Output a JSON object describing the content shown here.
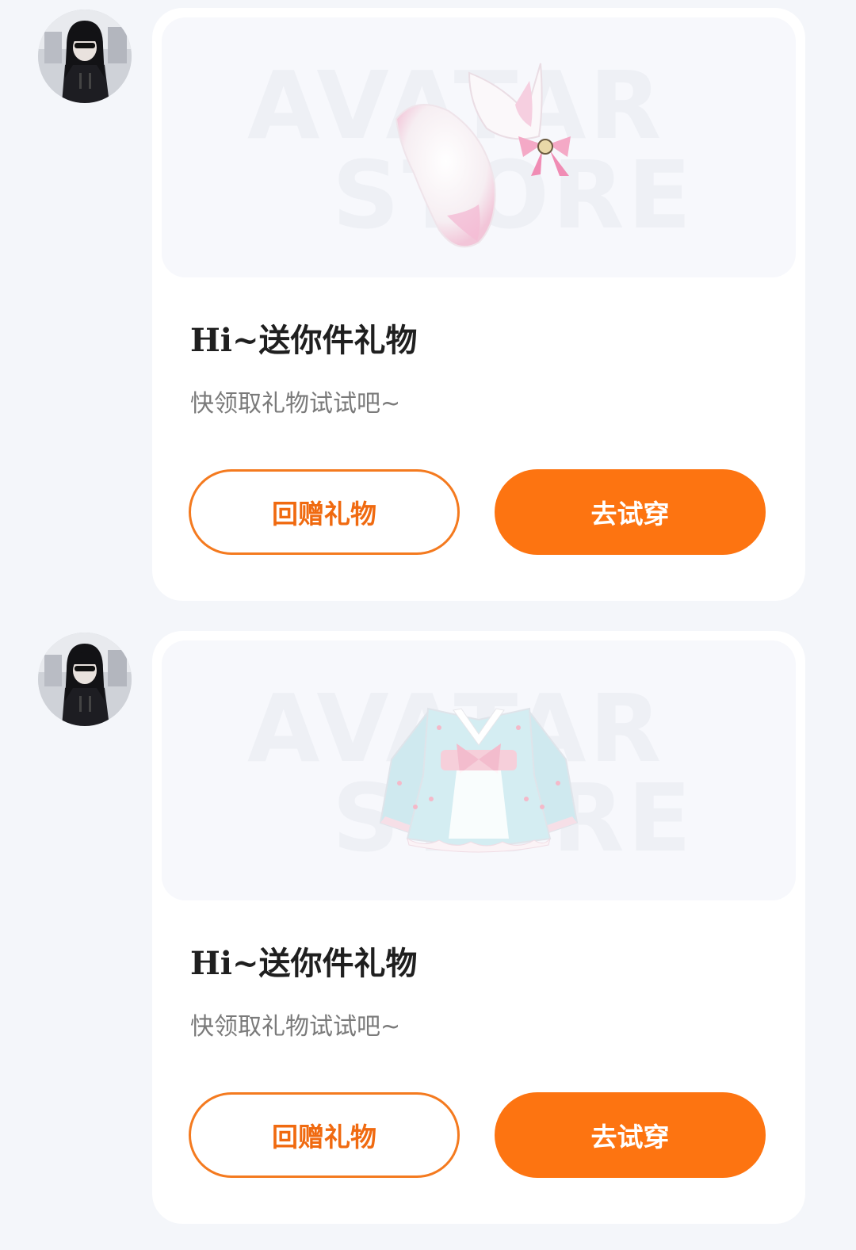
{
  "colors": {
    "background": "#f4f6fa",
    "card": "#ffffff",
    "accent": "#fd7411",
    "title_text": "#1f1f1f",
    "subtitle_text": "#7a7a7a"
  },
  "watermark": {
    "line1": "AVATAR",
    "line2": "STORE"
  },
  "messages": [
    {
      "avatar_icon": "user-avatar-icon",
      "item_icon": "fox-ear-tail-accessory-icon",
      "title": "Hi~送你件礼物",
      "subtitle": "快领取礼物试试吧~",
      "return_gift_label": "回赠礼物",
      "try_on_label": "去试穿"
    },
    {
      "avatar_icon": "user-avatar-icon",
      "item_icon": "blue-kimono-dress-icon",
      "title": "Hi~送你件礼物",
      "subtitle": "快领取礼物试试吧~",
      "return_gift_label": "回赠礼物",
      "try_on_label": "去试穿"
    }
  ]
}
